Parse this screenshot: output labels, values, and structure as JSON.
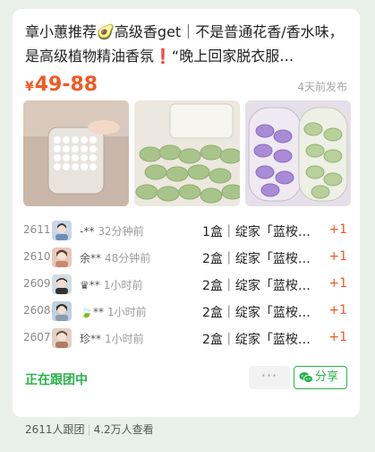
{
  "post": {
    "title": "章小蕙推荐🥑高级香get｜不是普通花香/香水味，是高级植物精油香氛❗“晚上回家脱衣服…",
    "price_symbol": "¥",
    "price": "49-88",
    "posted_time": "4天前发布"
  },
  "orders": [
    {
      "num": "2611",
      "buyer": "-**",
      "time": "32分钟前",
      "item": "1盒｜绽家「蓝桉…",
      "plus": "+1",
      "avatar_color": "#c9d6e6"
    },
    {
      "num": "2610",
      "buyer": "余**",
      "time": "48分钟前",
      "item": "2盒｜绽家「蓝桉…",
      "plus": "+1",
      "avatar_color": "#e8c9b8"
    },
    {
      "num": "2609",
      "buyer": "♛**",
      "time": "1小时前",
      "item": "2盒｜绽家「蓝桉…",
      "plus": "+1",
      "avatar_color": "#d4dbe3"
    },
    {
      "num": "2608",
      "buyer": "🍃**",
      "time": "1小时前",
      "item": "2盒｜绽家「蓝桉…",
      "plus": "+1",
      "avatar_color": "#c2cfdd"
    },
    {
      "num": "2607",
      "buyer": "珍**",
      "time": "1小时前",
      "item": "2盒｜绽家「蓝桉…",
      "plus": "+1",
      "avatar_color": "#e3cfc3"
    }
  ],
  "footer": {
    "status": "正在跟团中",
    "more": "···",
    "share": "分享",
    "participants": "2611人跟团",
    "views": "4.2万人查看"
  },
  "colors": {
    "accent_green": "#2bb24c",
    "price_orange": "#f05a22"
  },
  "icons": [
    "wechat-share-icon",
    "more-icon"
  ]
}
